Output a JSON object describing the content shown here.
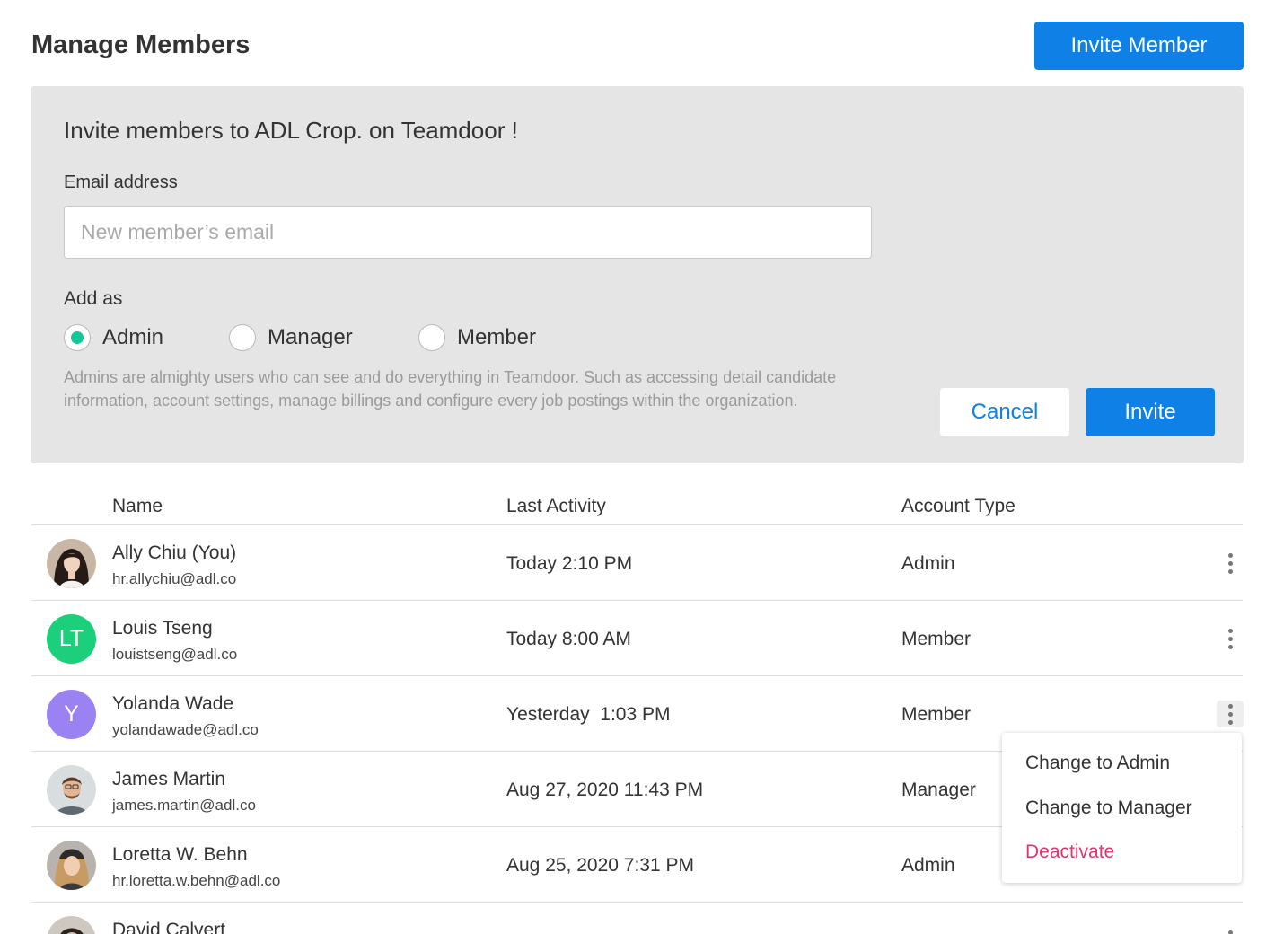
{
  "header": {
    "title": "Manage Members",
    "invite_member_label": "Invite Member"
  },
  "invite_panel": {
    "title": "Invite members to ADL Crop. on Teamdoor !",
    "email_label": "Email address",
    "email_value": "",
    "email_placeholder": "New member’s email",
    "add_as_label": "Add as",
    "roles": [
      {
        "label": "Admin",
        "selected": true
      },
      {
        "label": "Manager",
        "selected": false
      },
      {
        "label": "Member",
        "selected": false
      }
    ],
    "role_description": "Admins are almighty users who can see and do everything in Teamdoor. Such as accessing detail candidate information, account settings, manage billings and configure every job postings within the organization.",
    "cancel_label": "Cancel",
    "invite_label": "Invite"
  },
  "table": {
    "columns": [
      "Name",
      "Last Activity",
      "Account Type"
    ],
    "members": [
      {
        "name": "Ally Chiu (You)",
        "email": "hr.allychiu@adl.co",
        "last_activity": "Today 2:10 PM",
        "account_type": "Admin",
        "avatar": "photo"
      },
      {
        "name": "Louis Tseng",
        "email": "louistseng@adl.co",
        "last_activity": "Today 8:00 AM",
        "account_type": "Member",
        "avatar": "LT",
        "avatar_color": "#1ccf7a"
      },
      {
        "name": "Yolanda Wade",
        "email": "yolandawade@adl.co",
        "last_activity": "Yesterday  1:03 PM",
        "account_type": "Member",
        "avatar": "Y",
        "avatar_color": "#9b82f2"
      },
      {
        "name": "James Martin",
        "email": "james.martin@adl.co",
        "last_activity": "Aug 27, 2020 11:43 PM",
        "account_type": "Manager",
        "avatar": "photo"
      },
      {
        "name": "Loretta W. Behn",
        "email": "hr.loretta.w.behn@adl.co",
        "last_activity": "Aug 25, 2020 7:31 PM",
        "account_type": "Admin",
        "avatar": "photo"
      },
      {
        "name": "David Calvert",
        "email": "",
        "last_activity": "",
        "account_type": "",
        "avatar": "photo"
      }
    ]
  },
  "row_menu": {
    "items": [
      "Change to Admin",
      "Change to Manager",
      "Deactivate"
    ]
  },
  "colors": {
    "primary": "#0f80e6",
    "radio_selected": "#14c79a",
    "danger": "#e8336a",
    "panel_bg": "#e5e5e5"
  },
  "icons": [
    "more-vertical-icon"
  ]
}
